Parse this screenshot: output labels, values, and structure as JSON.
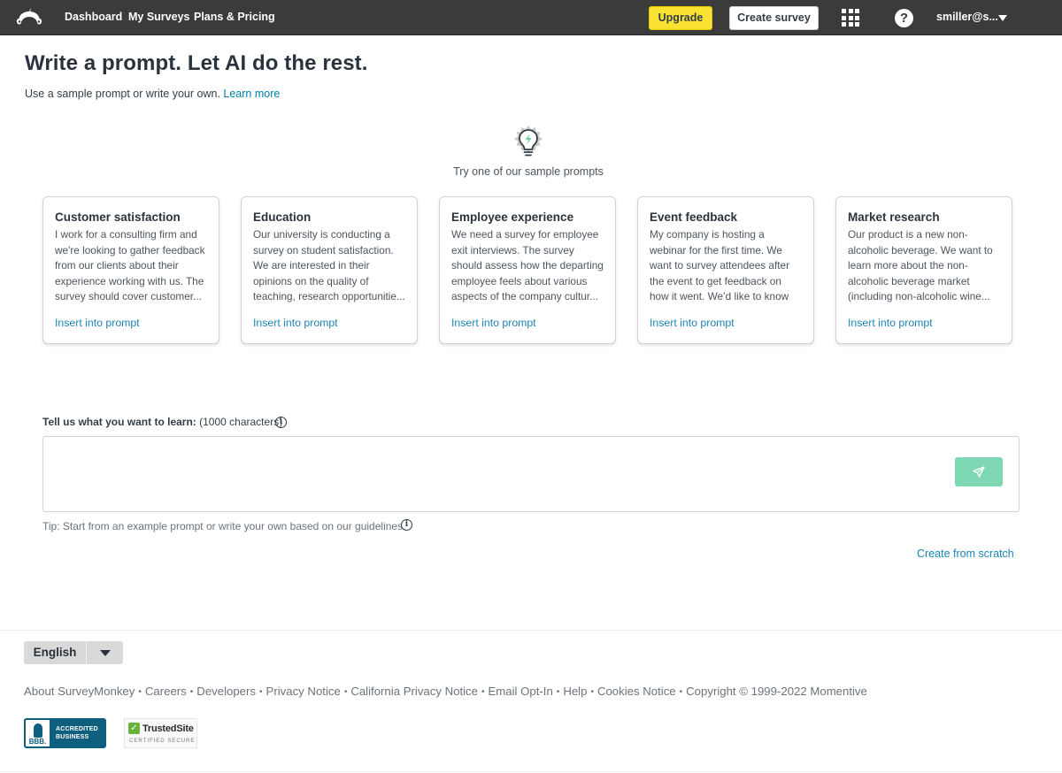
{
  "nav": {
    "links": [
      "Dashboard",
      "My Surveys",
      "Plans & Pricing"
    ],
    "upgrade_label": "Upgrade",
    "create_label": "Create survey",
    "help_glyph": "?",
    "account_label": "smiller@s...",
    "icons": {
      "logo": "surveymonkey-logo-icon",
      "apps": "apps-grid-icon",
      "help": "help-icon",
      "account": "chevron-down-icon"
    }
  },
  "header": {
    "title": "Write a prompt. Let AI do the rest.",
    "subtitle": "Use a sample prompt or write your own.",
    "learn_more": "Learn more"
  },
  "samples": {
    "intro": "Try one of our sample prompts",
    "link_label": "Insert into prompt",
    "cards": [
      {
        "title": "Customer satisfaction",
        "text": "I work for a consulting firm and we're looking to gather feedback from our clients about their experience working with us. The survey should cover customer..."
      },
      {
        "title": "Education",
        "text": "Our university is conducting a survey on student satisfaction. We are interested in their opinions on the quality of teaching, research opportunitie..."
      },
      {
        "title": "Employee experience",
        "text": "We need a survey for employee exit interviews. The survey should assess how the departing employee feels about various aspects of the company cultur..."
      },
      {
        "title": "Event feedback",
        "text": "My company is hosting a webinar for the first time. We want to survey attendees after the event to get feedback on how it went. We’d like to know their overall..."
      },
      {
        "title": "Market research",
        "text": "Our product is a new non-alcoholic beverage. We want to learn more about the non-alcoholic beverage market (including non-alcoholic wine..."
      }
    ]
  },
  "prompt": {
    "label": "Tell us what you want to learn:",
    "limit": "(1000 characters)",
    "value": "",
    "placeholder": "",
    "info_glyph": "i",
    "tip": "Tip: Start from an example prompt or write your own based on our guidelines.",
    "create_from_scratch": "Create from scratch",
    "send_color": "#7fd8b4"
  },
  "footer": {
    "language": "English",
    "links": [
      "About SurveyMonkey",
      "Careers",
      "Developers",
      "Privacy Notice",
      "California Privacy Notice",
      "Email Opt-In",
      "Help",
      "Cookies Notice"
    ],
    "copyright": "Copyright © 1999-2022 Momentive",
    "separator": "•",
    "bbb": {
      "mark": "BBB.",
      "line1": "ACCREDITED",
      "line2": "BUSINESS"
    },
    "trusted": {
      "check": "✓",
      "name": "TrustedSite",
      "sub": "CERTIFIED SECURE"
    }
  },
  "colors": {
    "nav_bg": "#3b3b3b",
    "upgrade": "#fae233",
    "link": "#1a86b5",
    "send": "#7fd8b4",
    "bbb": "#0e5f7e",
    "trusted_check": "#69b33c"
  }
}
